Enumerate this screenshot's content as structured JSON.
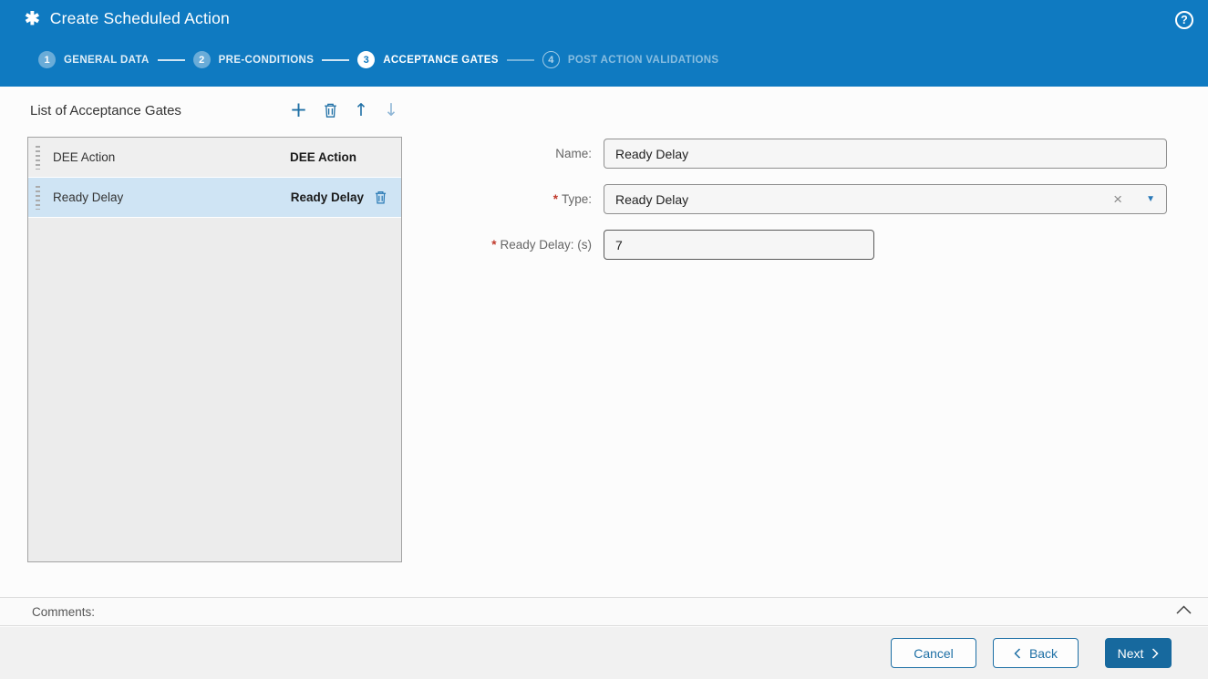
{
  "colors": {
    "header_blue": "#0f7ac1",
    "primary_button_blue": "#17699e",
    "outline_button_blue": "#1d6fa5",
    "selected_row_blue": "#cfe4f4",
    "toolbar_icon_blue": "#1e6fa5",
    "disabled_icon_blue": "#8fb6d6",
    "required_red": "#c0392b"
  },
  "header": {
    "title": "Create Scheduled Action",
    "asterisk_icon": "✱",
    "help_icon": "?"
  },
  "stepper": {
    "steps": [
      {
        "number": "1",
        "label": "GENERAL DATA",
        "state": "completed"
      },
      {
        "number": "2",
        "label": "PRE-CONDITIONS",
        "state": "completed"
      },
      {
        "number": "3",
        "label": "ACCEPTANCE GATES",
        "state": "active"
      },
      {
        "number": "4",
        "label": "POST ACTION VALIDATIONS",
        "state": "upcoming"
      }
    ]
  },
  "list_panel": {
    "title": "List of Acceptance Gates",
    "toolbar": {
      "add_icon": "+",
      "delete_icon": "trash",
      "move_up_icon": "↑",
      "move_down_icon": "↓"
    },
    "rows": [
      {
        "name": "DEE Action",
        "type": "DEE Action",
        "selected": false
      },
      {
        "name": "Ready Delay",
        "type": "Ready Delay",
        "selected": true
      }
    ]
  },
  "form": {
    "fields": [
      {
        "label": "Name:",
        "required_mark": "",
        "value": "Ready Delay"
      },
      {
        "label": "Type:",
        "required_mark": "*",
        "value": "Ready Delay",
        "clear_icon": "×",
        "dropdown_icon": "▼"
      },
      {
        "label": "Ready Delay: (s)",
        "required_mark": "*",
        "value": "7"
      }
    ]
  },
  "comments": {
    "label": "Comments:"
  },
  "footer": {
    "cancel_label": "Cancel",
    "back_label": "Back",
    "next_label": "Next"
  }
}
